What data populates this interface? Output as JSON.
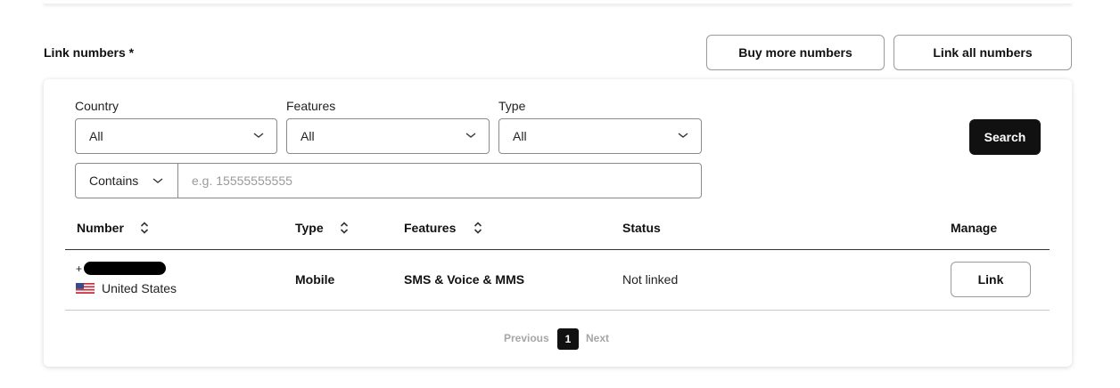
{
  "section": {
    "label": "Link numbers *"
  },
  "actions": {
    "buy_more": "Buy more numbers",
    "link_all": "Link all numbers"
  },
  "filters": {
    "country": {
      "label": "Country",
      "value": "All"
    },
    "features": {
      "label": "Features",
      "value": "All"
    },
    "type": {
      "label": "Type",
      "value": "All"
    },
    "search_button": "Search",
    "match_mode": "Contains",
    "number_placeholder": "e.g. 15555555555"
  },
  "table": {
    "headers": {
      "number": "Number",
      "type": "Type",
      "features": "Features",
      "status": "Status",
      "manage": "Manage"
    },
    "rows": [
      {
        "number_prefix": "+",
        "country": "United States",
        "type": "Mobile",
        "features": "SMS & Voice & MMS",
        "status": "Not linked",
        "action": "Link"
      }
    ]
  },
  "pagination": {
    "previous": "Previous",
    "current": "1",
    "next": "Next"
  },
  "colors": {
    "primary": "#111111",
    "border": "#8a8a8a",
    "muted": "#a6a6a6"
  },
  "icons": {
    "dropdown": "chevron-down-icon",
    "sort": "sort-icon",
    "flag": "us-flag-icon"
  }
}
